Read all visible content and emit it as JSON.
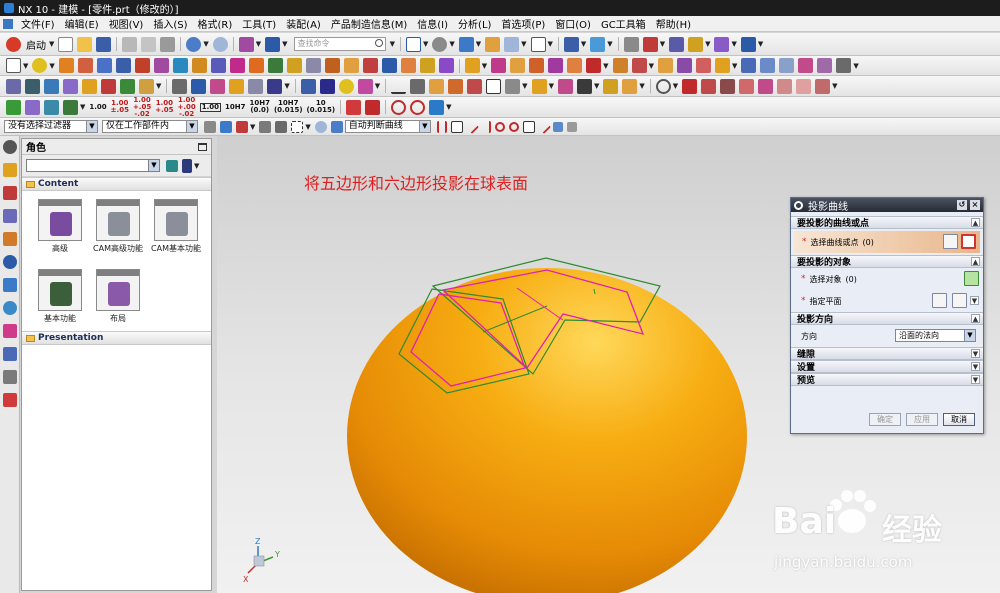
{
  "window": {
    "title": "NX 10 - 建模 - [零件.prt（修改的）]"
  },
  "menu": [
    "文件(F)",
    "编辑(E)",
    "视图(V)",
    "插入(S)",
    "格式(R)",
    "工具(T)",
    "装配(A)",
    "产品制造信息(M)",
    "信息(I)",
    "分析(L)",
    "首选项(P)",
    "窗口(O)",
    "GC工具箱",
    "帮助(H)"
  ],
  "toolbar1": {
    "start_label": "启动",
    "search_placeholder": "查找命令"
  },
  "toolbar4": {
    "formats": [
      "1.00",
      "1.00\n±.05",
      "1.00\n+.05\n-.02",
      "1.00\n+.05",
      "1.00\n+.00\n-.02",
      "1.00",
      "10H7",
      "10H7\n(0.0)",
      "10H7\n(0.015)",
      "10\n(0.015)"
    ]
  },
  "toolbar5": {
    "filter_value": "没有选择过滤器",
    "scope_value": "仅在工作部件内",
    "curve_rule_value": "自动判断曲线"
  },
  "roles_panel": {
    "title": "角色",
    "content_label": "Content",
    "presentation_label": "Presentation",
    "roles": [
      {
        "label": "高级",
        "icon": "tools-icon",
        "color": "#7a4ca0"
      },
      {
        "label": "CAM高级功能",
        "icon": "machining-icon",
        "color": "#8a8f9a"
      },
      {
        "label": "CAM基本功能",
        "icon": "machining-icon",
        "color": "#8a8f9a"
      },
      {
        "label": "基本功能",
        "icon": "tools-icon",
        "color": "#3a5f3a"
      },
      {
        "label": "布局",
        "icon": "drawing-icon",
        "color": "#8a5aa8"
      }
    ]
  },
  "viewport": {
    "annotation": "将五边形和六边形投影在球表面",
    "sphere_color": "#f5a00c",
    "pentagon_color": "#2e8b2e",
    "projected_color": "#e020b0",
    "axes": {
      "x": "X",
      "y": "Y",
      "z": "Z"
    }
  },
  "dialog": {
    "title": "投影曲线",
    "section_curves": "要投影的曲线或点",
    "select_curves_label": "选择曲线或点",
    "select_curves_count": "(0)",
    "section_target": "要投影的对象",
    "select_object_label": "选择对象",
    "select_object_count": "(0)",
    "specify_plane_label": "指定平面",
    "section_direction": "投影方向",
    "direction_label": "方向",
    "direction_value": "沿面的法向",
    "section_gap": "缝隙",
    "section_settings": "设置",
    "section_preview": "预览",
    "ok_label": "确定",
    "apply_label": "应用",
    "cancel_label": "取消"
  },
  "watermark": {
    "brand": "Bai",
    "brand_cn": "经验",
    "url": "jingyan.baidu.com"
  }
}
